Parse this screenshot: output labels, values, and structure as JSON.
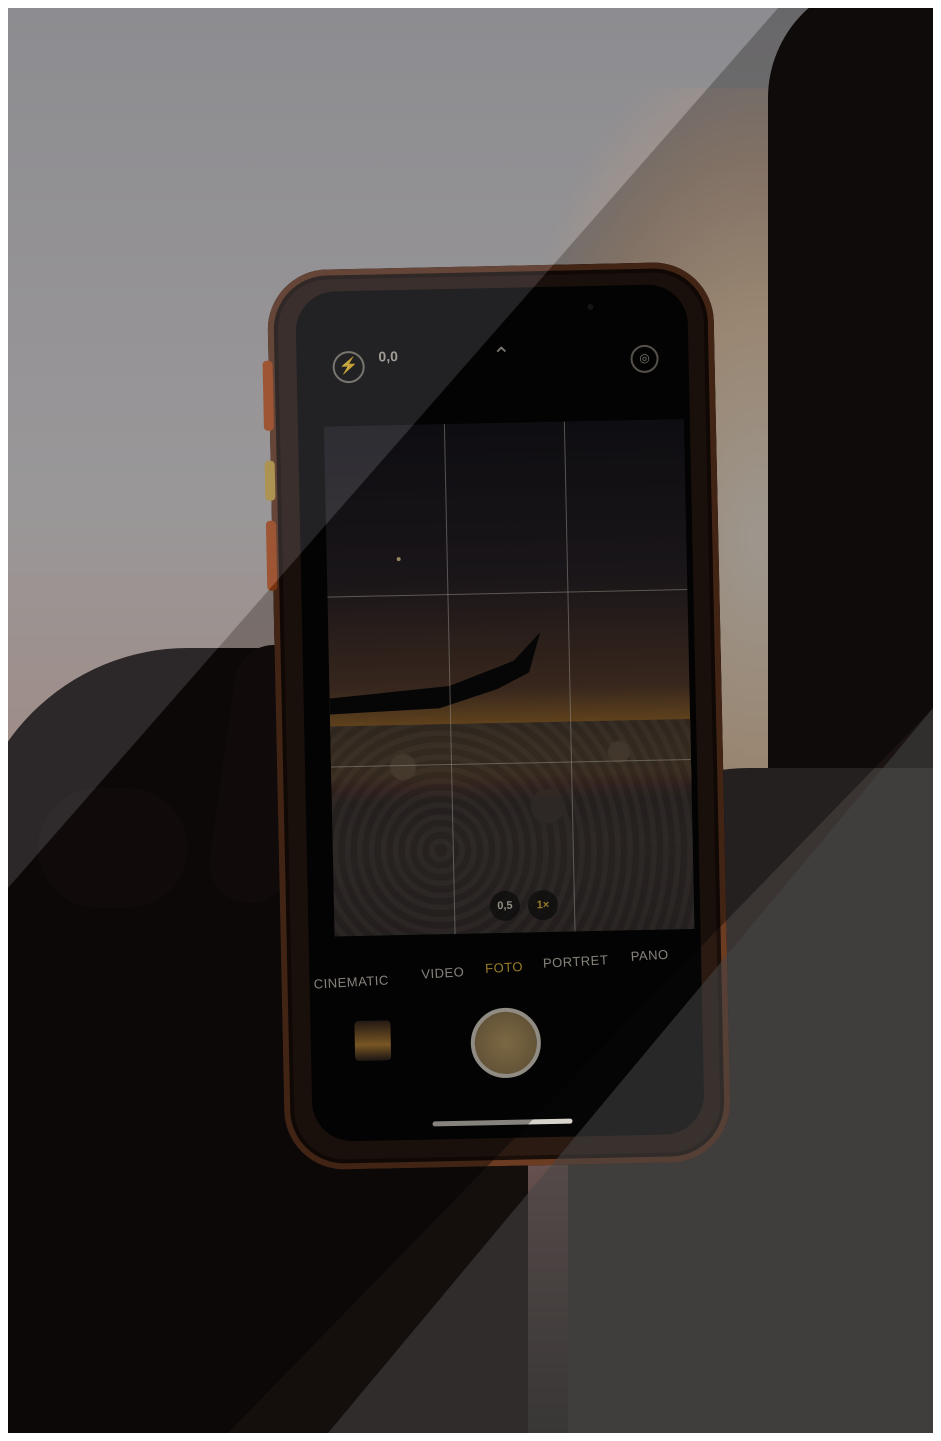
{
  "photo": {
    "subject": "",
    "accent_color": "#f4c542"
  },
  "camera_ui": {
    "exposure_value": "0,0",
    "chevron_icon": "chevron-up-icon",
    "flash_icon": "flash-off-icon",
    "live_icon": "live-photo-off-icon",
    "zoom_options": [
      "0,5",
      "1×"
    ],
    "modes": [
      "CINEMATIC",
      "VIDEO",
      "FOTO",
      "PORTRET",
      "PANO"
    ],
    "active_mode": "FOTO"
  }
}
